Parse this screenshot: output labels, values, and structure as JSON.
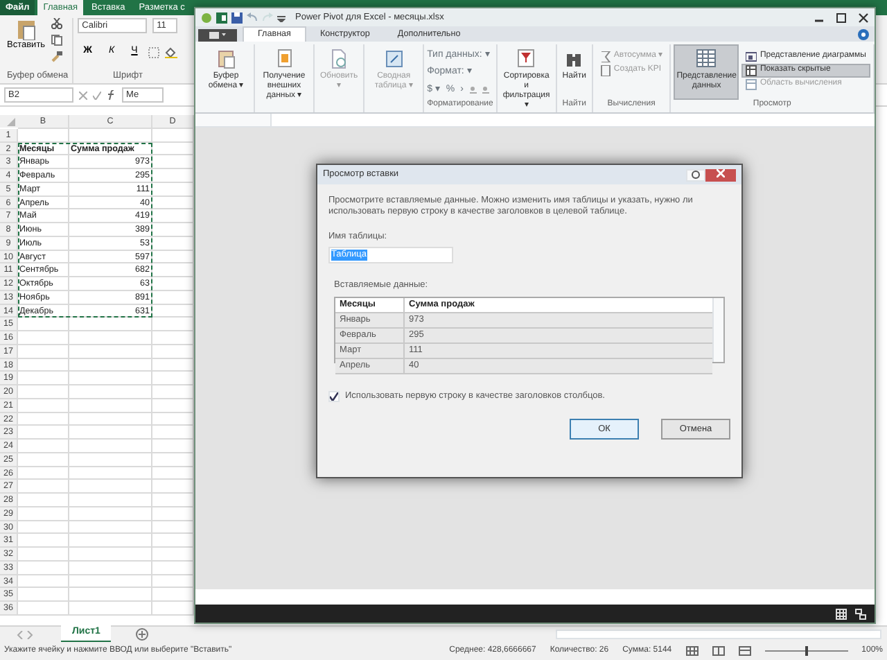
{
  "excel": {
    "tabs": [
      {
        "label": "Файл",
        "kind": "file",
        "selected": false
      },
      {
        "label": "Главная",
        "kind": "tab",
        "selected": true
      },
      {
        "label": "Вставка",
        "kind": "tab",
        "selected": false
      },
      {
        "label": "Разметка с",
        "kind": "tab",
        "selected": false
      }
    ],
    "clipboard": {
      "paste_label": "Вставить",
      "group": "Буфер обмена"
    },
    "font": {
      "name": "Calibri",
      "size": "11",
      "styles": [
        "Ж",
        "К",
        "Ч"
      ],
      "group": "Шрифт"
    },
    "name_box": "B2",
    "formula": "Ме",
    "columns": [
      "B",
      "C",
      "D"
    ],
    "rows": [
      {
        "number": "1",
        "cells": [
          "",
          ""
        ]
      },
      {
        "number": "2",
        "cells": [
          "Месяцы",
          "Сумма продаж"
        ],
        "kind": "header"
      },
      {
        "number": "3",
        "cells": [
          "Январь",
          "973"
        ]
      },
      {
        "number": "4",
        "cells": [
          "Февраль",
          "295"
        ]
      },
      {
        "number": "5",
        "cells": [
          "Март",
          "111"
        ]
      },
      {
        "number": "6",
        "cells": [
          "Апрель",
          "40"
        ]
      },
      {
        "number": "7",
        "cells": [
          "Май",
          "419"
        ]
      },
      {
        "number": "8",
        "cells": [
          "Июнь",
          "389"
        ]
      },
      {
        "number": "9",
        "cells": [
          "Июль",
          "53"
        ]
      },
      {
        "number": "10",
        "cells": [
          "Август",
          "597"
        ]
      },
      {
        "number": "11",
        "cells": [
          "Сентябрь",
          "682"
        ]
      },
      {
        "number": "12",
        "cells": [
          "Октябрь",
          "63"
        ]
      },
      {
        "number": "13",
        "cells": [
          "Ноябрь",
          "891"
        ]
      },
      {
        "number": "14",
        "cells": [
          "Декабрь",
          "631"
        ]
      },
      {
        "number": "15",
        "cells": [
          "",
          ""
        ]
      },
      {
        "number": "16",
        "cells": [
          "",
          ""
        ]
      },
      {
        "number": "17",
        "cells": [
          "",
          ""
        ]
      },
      {
        "number": "18",
        "cells": [
          "",
          ""
        ]
      },
      {
        "number": "19",
        "cells": [
          "",
          ""
        ]
      },
      {
        "number": "20",
        "cells": [
          "",
          ""
        ]
      },
      {
        "number": "21",
        "cells": [
          "",
          ""
        ]
      },
      {
        "number": "22",
        "cells": [
          "",
          ""
        ]
      },
      {
        "number": "23",
        "cells": [
          "",
          ""
        ]
      },
      {
        "number": "24",
        "cells": [
          "",
          ""
        ]
      },
      {
        "number": "25",
        "cells": [
          "",
          ""
        ]
      },
      {
        "number": "26",
        "cells": [
          "",
          ""
        ]
      },
      {
        "number": "27",
        "cells": [
          "",
          ""
        ]
      },
      {
        "number": "28",
        "cells": [
          "",
          ""
        ]
      },
      {
        "number": "29",
        "cells": [
          "",
          ""
        ]
      },
      {
        "number": "30",
        "cells": [
          "",
          ""
        ]
      },
      {
        "number": "31",
        "cells": [
          "",
          ""
        ]
      },
      {
        "number": "32",
        "cells": [
          "",
          ""
        ]
      },
      {
        "number": "33",
        "cells": [
          "",
          ""
        ]
      },
      {
        "number": "34",
        "cells": [
          "",
          ""
        ]
      },
      {
        "number": "35",
        "cells": [
          "",
          ""
        ]
      },
      {
        "number": "36",
        "cells": [
          "",
          ""
        ]
      }
    ],
    "sheet_tabs": [
      {
        "label": "Лист1",
        "selected": true
      }
    ],
    "status_bar": {
      "message": "Укажите ячейку и нажмите ВВОД или выберите \"Вставить\"",
      "average": "Среднее: 428,6666667",
      "count": "Количество: 26",
      "sum": "Сумма: 5144",
      "zoom": "100%",
      "zoom_slider": {
        "level": 0.5
      }
    }
  },
  "power_pivot": {
    "title": "Power Pivot для Excel - месяцы.xlsx",
    "tabs": [
      {
        "label": "Главная",
        "selected": true
      },
      {
        "label": "Конструктор",
        "selected": false
      },
      {
        "label": "Дополнительно",
        "selected": false
      }
    ],
    "groups": [
      {
        "kind": "buttons",
        "buttons": [
          {
            "label": "Буфер обмена ▾",
            "kind": "large",
            "disabled": false,
            "selected": false
          }
        ]
      },
      {
        "kind": "buttons",
        "buttons": [
          {
            "label": "Получение внешних данных ▾",
            "kind": "large",
            "disabled": false,
            "selected": false
          }
        ]
      },
      {
        "kind": "buttons",
        "buttons": [
          {
            "label": "Обновить ▾",
            "kind": "large",
            "disabled": true,
            "selected": false
          }
        ]
      },
      {
        "kind": "buttons",
        "buttons": [
          {
            "label": "Сводная таблица ▾",
            "kind": "large",
            "disabled": true,
            "selected": false
          }
        ]
      },
      {
        "kind": "format",
        "label": "Форматирование",
        "fields": [
          "Тип данных: ▾",
          "Формат: ▾"
        ],
        "symbols": [
          "$ ▾",
          "%",
          "›"
        ]
      },
      {
        "kind": "buttons",
        "buttons": [
          {
            "label": "Сортировка и фильтрация ▾",
            "kind": "large",
            "disabled": false,
            "selected": false
          }
        ]
      },
      {
        "kind": "buttons",
        "label": "Найти",
        "buttons": [
          {
            "label": "Найти",
            "kind": "large",
            "disabled": false,
            "selected": false
          }
        ]
      },
      {
        "kind": "buttons",
        "label": "Вычисления",
        "buttons": [
          {
            "label": "Автосумма ▾",
            "kind": "small",
            "disabled": true,
            "selected": false
          },
          {
            "label": "Создать KPI",
            "kind": "small",
            "disabled": true,
            "selected": false
          }
        ]
      },
      {
        "kind": "buttons",
        "label": "Просмотр",
        "buttons": [
          {
            "label": "Представление данных",
            "kind": "large",
            "disabled": false,
            "selected": true
          },
          {
            "label": "Представление диаграммы",
            "kind": "small",
            "disabled": false,
            "selected": false
          },
          {
            "label": "Показать скрытые",
            "kind": "small",
            "disabled": false,
            "selected": true
          },
          {
            "label": "Область вычисления",
            "kind": "small",
            "disabled": true,
            "selected": false
          }
        ]
      }
    ]
  },
  "dialog": {
    "title": "Просмотр вставки",
    "description": "Просмотрите вставляемые данные. Можно изменить имя таблицы и указать, нужно ли использовать первую строку в качестве заголовков в целевой таблице.",
    "table_name_label": "Имя таблицы:",
    "table_name": "Таблица",
    "data_label": "Вставляемые данные:",
    "columns": [
      "Месяцы",
      "Сумма продаж"
    ],
    "rows": [
      [
        "Январь",
        "973"
      ],
      [
        "Февраль",
        "295"
      ],
      [
        "Март",
        "111"
      ],
      [
        "Апрель",
        "40"
      ]
    ],
    "use_header": {
      "label": "Использовать первую строку в качестве заголовков столбцов.",
      "checked": true
    },
    "buttons": [
      {
        "label": "ОК",
        "kind": "default"
      },
      {
        "label": "Отмена",
        "kind": "normal"
      }
    ]
  }
}
